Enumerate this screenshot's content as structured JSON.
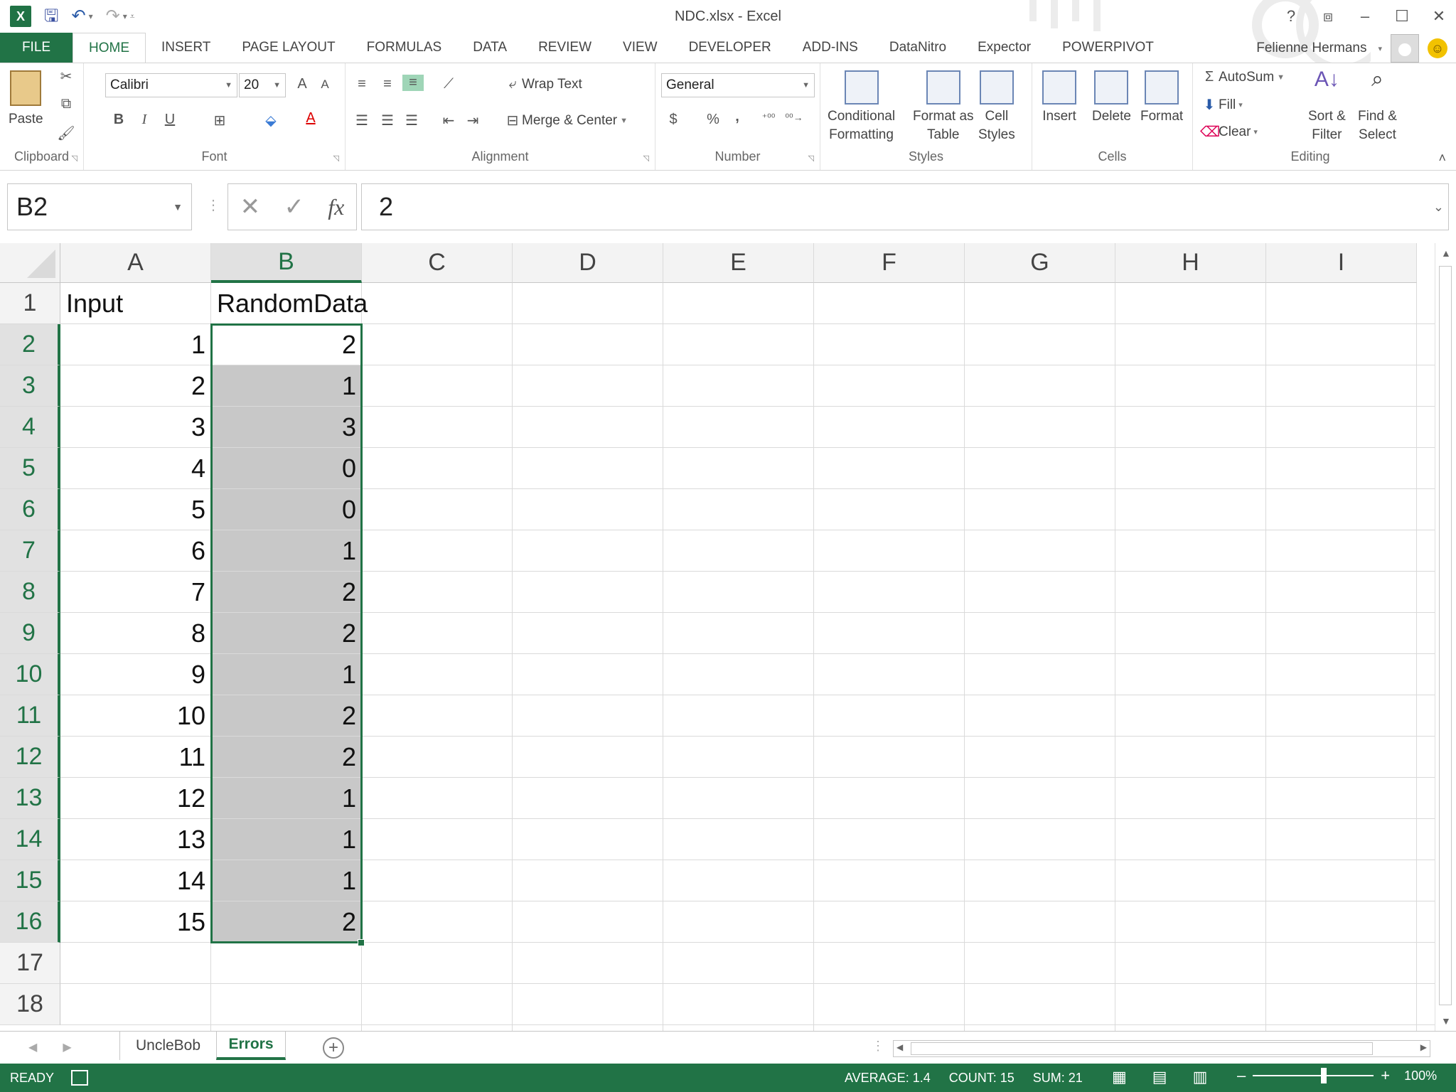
{
  "window": {
    "title": "NDC.xlsx - Excel",
    "app_logo": "X",
    "help": "?",
    "controls": [
      "ribbon-display-icon",
      "minimize-icon",
      "maximize-icon",
      "close-icon"
    ]
  },
  "qat": {
    "icons": [
      "excel-logo-icon",
      "save-icon",
      "undo-icon",
      "redo-icon",
      "customize-icon"
    ]
  },
  "tabs": [
    "FILE",
    "HOME",
    "INSERT",
    "PAGE LAYOUT",
    "FORMULAS",
    "DATA",
    "REVIEW",
    "VIEW",
    "DEVELOPER",
    "ADD-INS",
    "DataNitro",
    "Expector",
    "POWERPIVOT"
  ],
  "active_tab": "HOME",
  "user": {
    "name": "Felienne Hermans"
  },
  "ribbon": {
    "clipboard": {
      "label": "Clipboard",
      "paste": "Paste"
    },
    "font": {
      "label": "Font",
      "name": "Calibri",
      "size": "20",
      "bold": "B",
      "italic": "I",
      "underline": "U"
    },
    "alignment": {
      "label": "Alignment",
      "wrap": "Wrap Text",
      "merge": "Merge & Center"
    },
    "number": {
      "label": "Number",
      "format": "General",
      "currency": "$",
      "percent": "%",
      "comma": ","
    },
    "styles": {
      "label": "Styles",
      "conditional_1": "Conditional",
      "conditional_2": "Formatting",
      "format_table_1": "Format as",
      "format_table_2": "Table",
      "cell_styles_1": "Cell",
      "cell_styles_2": "Styles"
    },
    "cells": {
      "label": "Cells",
      "insert": "Insert",
      "delete": "Delete",
      "format": "Format"
    },
    "editing": {
      "label": "Editing",
      "autosum": "AutoSum",
      "fill": "Fill",
      "clear": "Clear",
      "sort_1": "Sort &",
      "sort_2": "Filter",
      "find_1": "Find &",
      "find_2": "Select"
    }
  },
  "formula_bar": {
    "name_box": "B2",
    "formula": "2",
    "fx": "fx"
  },
  "grid": {
    "columns": [
      "A",
      "B",
      "C",
      "D",
      "E",
      "F",
      "G",
      "H",
      "I"
    ],
    "selected_column": "B",
    "rows": [
      "1",
      "2",
      "3",
      "4",
      "5",
      "6",
      "7",
      "8",
      "9",
      "10",
      "11",
      "12",
      "13",
      "14",
      "15",
      "16",
      "17",
      "18"
    ],
    "selected_rows": [
      "2",
      "3",
      "4",
      "5",
      "6",
      "7",
      "8",
      "9",
      "10",
      "11",
      "12",
      "13",
      "14",
      "15",
      "16"
    ],
    "header_a": "Input",
    "header_b": "RandomData",
    "col_a": [
      "1",
      "2",
      "3",
      "4",
      "5",
      "6",
      "7",
      "8",
      "9",
      "10",
      "11",
      "12",
      "13",
      "14",
      "15"
    ],
    "col_b": [
      "2",
      "1",
      "3",
      "0",
      "0",
      "1",
      "2",
      "2",
      "1",
      "2",
      "2",
      "1",
      "1",
      "1",
      "2"
    ]
  },
  "sheets": {
    "tabs": [
      "UncleBob",
      "Errors"
    ],
    "active": "Errors"
  },
  "status": {
    "ready": "READY",
    "average": "AVERAGE: 1.4",
    "count": "COUNT: 15",
    "sum": "SUM: 21",
    "zoom": "100%",
    "zoom_level": 1.0
  },
  "colors": {
    "accent": "#217346",
    "selection": "#c8c8c8"
  }
}
